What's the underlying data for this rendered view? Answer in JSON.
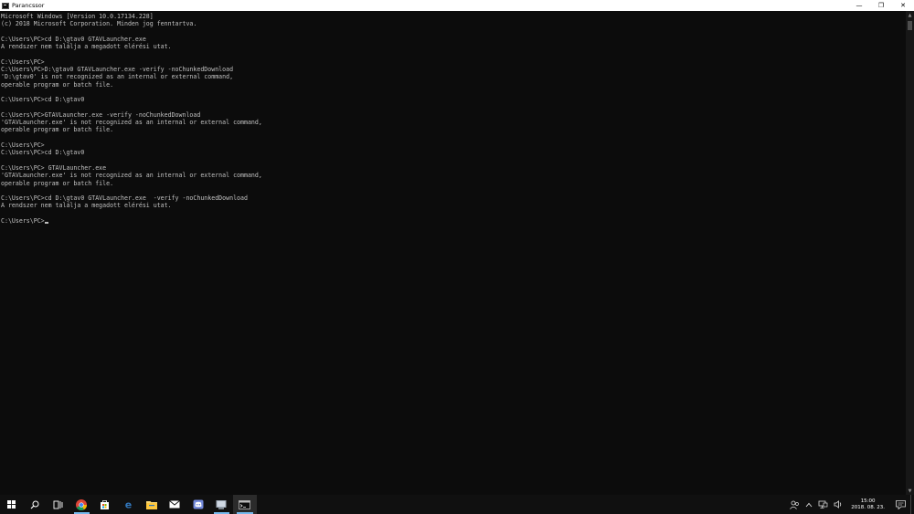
{
  "window": {
    "title": "Parancssor",
    "controls": {
      "minimize": "—",
      "restore": "❐",
      "close": "✕"
    }
  },
  "console": {
    "lines": [
      "Microsoft Windows [Version 10.0.17134.228]",
      "(c) 2018 Microsoft Corporation. Minden jog fenntartva.",
      "",
      "C:\\Users\\PC>cd D:\\gtav0 GTAVLauncher.exe",
      "A rendszer nem találja a megadott elérési utat.",
      "",
      "C:\\Users\\PC>",
      "C:\\Users\\PC>D:\\gtav0 GTAVLauncher.exe -verify -noChunkedDownload",
      "'D:\\gtav0' is not recognized as an internal or external command,",
      "operable program or batch file.",
      "",
      "C:\\Users\\PC>cd D:\\gtav0",
      "",
      "C:\\Users\\PC>GTAVLauncher.exe -verify -noChunkedDownload",
      "'GTAVLauncher.exe' is not recognized as an internal or external command,",
      "operable program or batch file.",
      "",
      "C:\\Users\\PC>",
      "C:\\Users\\PC>cd D:\\gtav0",
      "",
      "C:\\Users\\PC> GTAVLauncher.exe",
      "'GTAVLauncher.exe' is not recognized as an internal or external command,",
      "operable program or batch file.",
      "",
      "C:\\Users\\PC>cd D:\\gtav0 GTAVLauncher.exe  -verify -noChunkedDownload",
      "A rendszer nem találja a megadott elérési utat.",
      ""
    ],
    "prompt": "C:\\Users\\PC>"
  },
  "taskbar": {
    "apps": [
      {
        "name": "start",
        "icon": "windows-logo-icon"
      },
      {
        "name": "search",
        "icon": "search-icon"
      },
      {
        "name": "task-view",
        "icon": "task-view-icon"
      },
      {
        "name": "chrome",
        "icon": "chrome-icon",
        "running": true
      },
      {
        "name": "store",
        "icon": "store-icon"
      },
      {
        "name": "edge",
        "icon": "edge-icon"
      },
      {
        "name": "file-explorer",
        "icon": "folder-icon"
      },
      {
        "name": "mail",
        "icon": "mail-icon"
      },
      {
        "name": "discord",
        "icon": "discord-icon"
      },
      {
        "name": "app",
        "icon": "app-icon",
        "running": true
      },
      {
        "name": "command-prompt",
        "icon": "cmd-icon",
        "running": true,
        "active": true
      }
    ],
    "tray": {
      "time": "15:00",
      "date": "2018. 08. 23."
    }
  },
  "colors": {
    "console_bg": "#0c0c0c",
    "console_text": "#c0c0c0",
    "taskbar_bg": "#101010",
    "accent": "#76b9ed"
  }
}
